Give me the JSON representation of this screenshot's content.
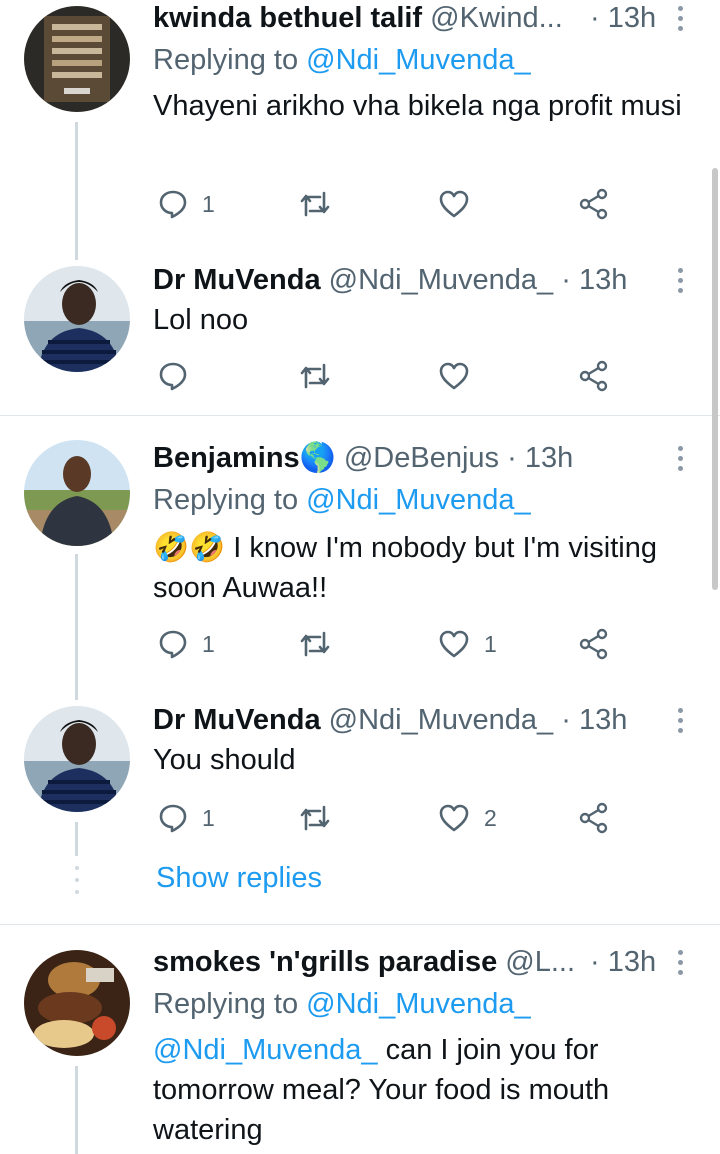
{
  "tweets": [
    {
      "name": "kwinda bethuel talif",
      "handle": "@Kwind...",
      "dot": "·",
      "time": "13h",
      "replying_prefix": "Replying to",
      "replying_to": "@Ndi_Muvenda_",
      "text": "Vhayeni arikho vha bikela nga profit musi",
      "reply_count": "1",
      "retweet_count": "",
      "like_count": ""
    },
    {
      "name": "Dr MuVenda",
      "handle": "@Ndi_Muvenda_",
      "dot": "·",
      "time": "13h",
      "text": "Lol noo",
      "reply_count": "",
      "retweet_count": "",
      "like_count": ""
    },
    {
      "name": "Benjamins",
      "name_emoji": "🌎",
      "handle": "@DeBenjus",
      "dot": "·",
      "time": "13h",
      "replying_prefix": "Replying to",
      "replying_to": "@Ndi_Muvenda_",
      "text_emoji": "🤣🤣",
      "text": " I know I'm nobody but I'm visiting soon Auwaa!!",
      "reply_count": "1",
      "retweet_count": "",
      "like_count": "1"
    },
    {
      "name": "Dr MuVenda",
      "handle": "@Ndi_Muvenda_",
      "dot": "·",
      "time": "13h",
      "text": "You should",
      "reply_count": "1",
      "retweet_count": "",
      "like_count": "2"
    },
    {
      "name": "smokes 'n'grills paradise",
      "handle": "@L...",
      "dot": "·",
      "time": "13h",
      "replying_prefix": "Replying to",
      "replying_to": "@Ndi_Muvenda_",
      "text_mention": "@Ndi_Muvenda_",
      "text": " can I join you for tomorrow meal? Your food is mouth watering"
    }
  ],
  "show_replies": "Show replies",
  "colors": {
    "accent": "#1d9bf0",
    "muted": "#536471",
    "text": "#0f1419"
  }
}
